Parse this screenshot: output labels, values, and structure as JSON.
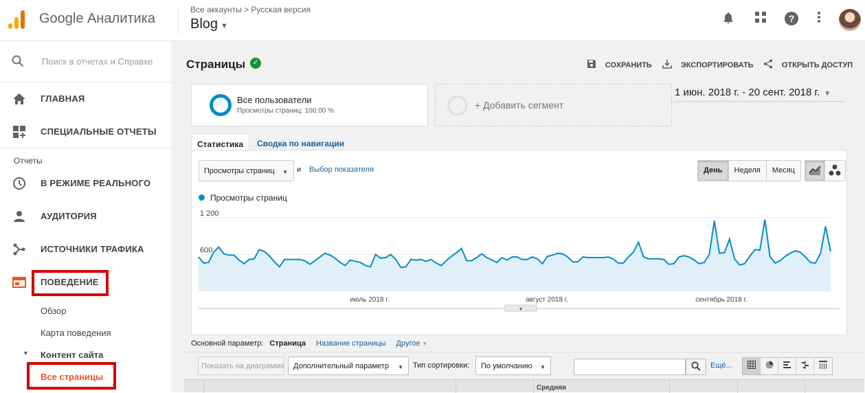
{
  "topbar": {
    "brand": "Google Аналитика",
    "breadcrumb": "Все аккаунты > Русская версия",
    "property": "Blog",
    "icons": [
      "bell-icon",
      "apps-grid-icon",
      "help-icon",
      "more-vert-icon",
      "avatar"
    ]
  },
  "sidebar": {
    "search_placeholder": "Поиск в отчетах и Справке",
    "home": "ГЛАВНАЯ",
    "custom_reports": "СПЕЦИАЛЬНЫЕ ОТЧЕТЫ",
    "reports_header": "Отчеты",
    "realtime": "В РЕЖИМЕ РЕАЛЬНОГО",
    "audience": "АУДИТОРИЯ",
    "acquisition": "ИСТОЧНИКИ ТРАФИКА",
    "behavior": "ПОВЕДЕНИЕ",
    "overview": "Обзор",
    "behavior_flow": "Карта поведения",
    "site_content": "Контент сайта",
    "all_pages": "Все страницы"
  },
  "header": {
    "title": "Страницы",
    "save": "СОХРАНИТЬ",
    "export": "ЭКСПОРТИРОВАТЬ",
    "share": "ОТКРЫТЬ ДОСТУП"
  },
  "segment": {
    "name": "Все пользователи",
    "detail": "Просмотры страниц: 100,00 %",
    "add": "+ Добавить сегмент"
  },
  "date_range": "1 июн. 2018 г. - 20 сент. 2018 г.",
  "tabs": [
    "Статистика",
    "Сводка по навигации"
  ],
  "chart_controls": {
    "metric_select": "Просмотры страниц",
    "and": "и",
    "choose_metric": "Выбор показателя",
    "day": "День",
    "week": "Неделя",
    "month": "Месяц"
  },
  "chart_data": {
    "type": "area",
    "series": [
      {
        "name": "Просмотры страниц",
        "values": [
          560,
          460,
          470,
          640,
          720,
          610,
          590,
          590,
          510,
          450,
          520,
          530,
          680,
          650,
          580,
          480,
          400,
          520,
          520,
          520,
          520,
          500,
          440,
          500,
          560,
          620,
          590,
          540,
          470,
          420,
          510,
          490,
          470,
          420,
          400,
          600,
          540,
          550,
          600,
          520,
          390,
          400,
          520,
          510,
          520,
          490,
          520,
          460,
          420,
          500,
          570,
          630,
          700,
          500,
          500,
          550,
          610,
          550,
          510,
          470,
          550,
          510,
          560,
          560,
          520,
          520,
          560,
          530,
          450,
          570,
          590,
          620,
          610,
          560,
          480,
          480,
          560,
          550,
          550,
          550,
          550,
          560,
          530,
          460,
          460,
          560,
          640,
          800,
          560,
          530,
          530,
          530,
          520,
          440,
          450,
          560,
          580,
          560,
          510,
          450,
          470,
          600,
          1150,
          620,
          630,
          850,
          530,
          430,
          450,
          570,
          680,
          670,
          1170,
          570,
          460,
          500,
          570,
          620,
          660,
          640,
          560,
          470,
          460,
          620,
          1060,
          650
        ]
      }
    ],
    "x_labels": [
      "июль 2018 г.",
      "август 2018 г.",
      "сентябрь 2018 г."
    ],
    "y_ticks": [
      "1 200",
      "600"
    ],
    "ylim": [
      0,
      1400
    ],
    "grid": true,
    "color": "#058dc7",
    "fill": "#e1f0f8"
  },
  "dimension": {
    "label": "Основной параметр:",
    "active": "Страница",
    "page_title": "Название страницы",
    "other": "Другое"
  },
  "table_toolbar": {
    "plot_rows": "Показать на диаграмме",
    "secondary": "Дополнительный параметр",
    "sort_label": "Тип сортировки:",
    "sort_value": "По умолчанию",
    "more": "Ещё..."
  },
  "table_header_partial": "Средняя"
}
